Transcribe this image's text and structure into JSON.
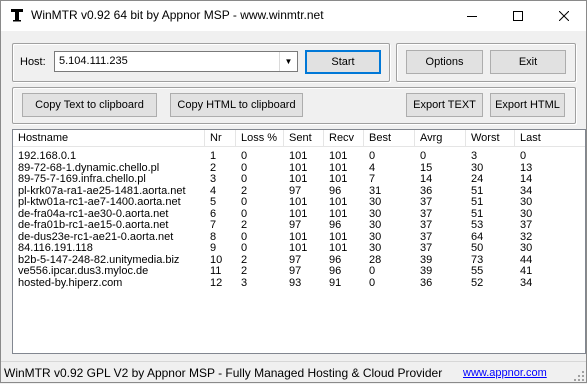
{
  "window": {
    "title": "WinMTR v0.92 64 bit by Appnor MSP - www.winmtr.net"
  },
  "host": {
    "label": "Host:",
    "value": "5.104.111.235"
  },
  "buttons": {
    "start": "Start",
    "options": "Options",
    "exit": "Exit",
    "copy_text": "Copy Text to clipboard",
    "copy_html": "Copy HTML to clipboard",
    "export_text": "Export TEXT",
    "export_html": "Export HTML"
  },
  "table": {
    "columns": [
      "Hostname",
      "Nr",
      "Loss %",
      "Sent",
      "Recv",
      "Best",
      "Avrg",
      "Worst",
      "Last"
    ],
    "rows": [
      [
        "192.168.0.1",
        "1",
        "0",
        "101",
        "101",
        "0",
        "0",
        "3",
        "0"
      ],
      [
        "89-72-68-1.dynamic.chello.pl",
        "2",
        "0",
        "101",
        "101",
        "4",
        "15",
        "30",
        "13"
      ],
      [
        "89-75-7-169.infra.chello.pl",
        "3",
        "0",
        "101",
        "101",
        "7",
        "14",
        "24",
        "14"
      ],
      [
        "pl-krk07a-ra1-ae25-1481.aorta.net",
        "4",
        "2",
        "97",
        "96",
        "31",
        "36",
        "51",
        "34"
      ],
      [
        "pl-ktw01a-rc1-ae7-1400.aorta.net",
        "5",
        "0",
        "101",
        "101",
        "30",
        "37",
        "51",
        "30"
      ],
      [
        "de-fra04a-rc1-ae30-0.aorta.net",
        "6",
        "0",
        "101",
        "101",
        "30",
        "37",
        "51",
        "30"
      ],
      [
        "de-fra01b-rc1-ae15-0.aorta.net",
        "7",
        "2",
        "97",
        "96",
        "30",
        "37",
        "53",
        "37"
      ],
      [
        "de-dus23e-rc1-ae21-0.aorta.net",
        "8",
        "0",
        "101",
        "101",
        "30",
        "37",
        "64",
        "32"
      ],
      [
        "84.116.191.118",
        "9",
        "0",
        "101",
        "101",
        "30",
        "37",
        "50",
        "30"
      ],
      [
        "b2b-5-147-248-82.unitymedia.biz",
        "10",
        "2",
        "97",
        "96",
        "28",
        "39",
        "73",
        "44"
      ],
      [
        "ve556.ipcar.dus3.myloc.de",
        "11",
        "2",
        "97",
        "96",
        "0",
        "39",
        "55",
        "41"
      ],
      [
        "hosted-by.hiperz.com",
        "12",
        "3",
        "93",
        "91",
        "0",
        "36",
        "52",
        "34"
      ]
    ]
  },
  "status": {
    "text": "WinMTR v0.92 GPL V2 by Appnor MSP - Fully Managed Hosting & Cloud Provider",
    "link": "www.appnor.com"
  }
}
